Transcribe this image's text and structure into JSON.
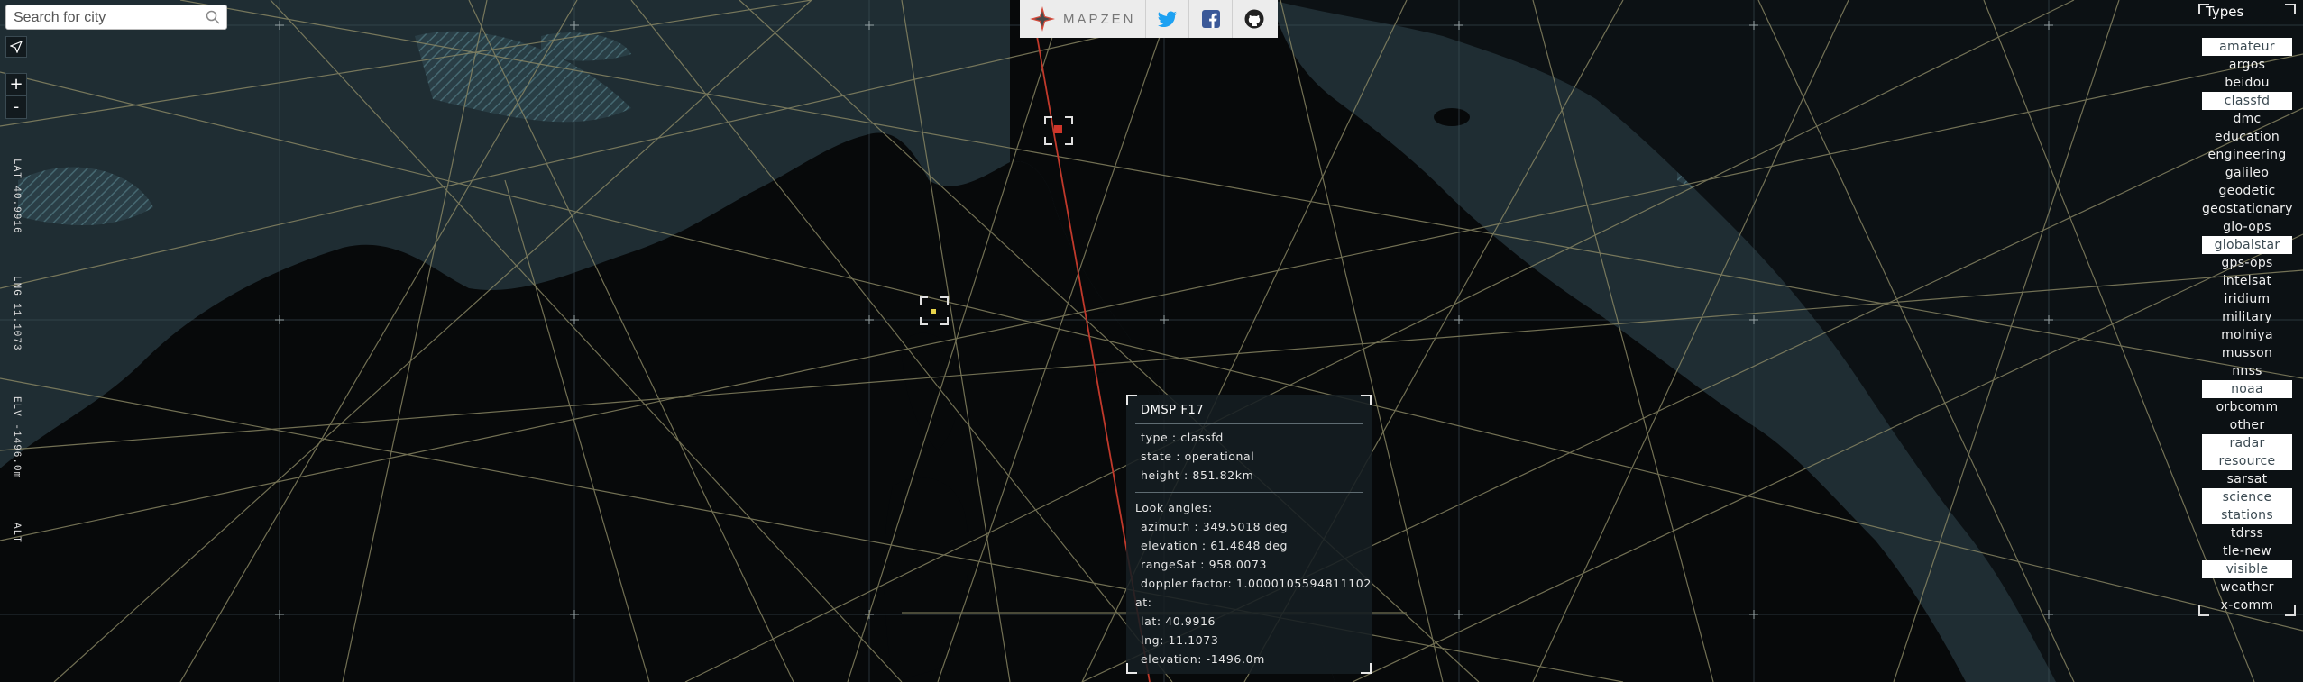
{
  "search": {
    "placeholder": "Search for city"
  },
  "controls": {
    "zoom_in": "+",
    "zoom_out": "-"
  },
  "coords": {
    "lat": "LAT 40.9916",
    "lng": "LNG 11.1073",
    "elv": "ELV -1496.0m",
    "alt": "ALT"
  },
  "header": {
    "brand": "MAPZEN"
  },
  "types": {
    "title": "Types",
    "items": [
      {
        "label": "amateur",
        "active": true
      },
      {
        "label": "argos",
        "active": false
      },
      {
        "label": "beidou",
        "active": false
      },
      {
        "label": "classfd",
        "active": true
      },
      {
        "label": "dmc",
        "active": false
      },
      {
        "label": "education",
        "active": false
      },
      {
        "label": "engineering",
        "active": false
      },
      {
        "label": "galileo",
        "active": false
      },
      {
        "label": "geodetic",
        "active": false
      },
      {
        "label": "geostationary",
        "active": false
      },
      {
        "label": "glo-ops",
        "active": false
      },
      {
        "label": "globalstar",
        "active": true
      },
      {
        "label": "gps-ops",
        "active": false
      },
      {
        "label": "intelsat",
        "active": false
      },
      {
        "label": "iridium",
        "active": false
      },
      {
        "label": "military",
        "active": false
      },
      {
        "label": "molniya",
        "active": false
      },
      {
        "label": "musson",
        "active": false
      },
      {
        "label": "nnss",
        "active": false
      },
      {
        "label": "noaa",
        "active": true
      },
      {
        "label": "orbcomm",
        "active": false
      },
      {
        "label": "other",
        "active": false
      },
      {
        "label": "radar resource",
        "active": true
      },
      {
        "label": "sarsat",
        "active": false
      },
      {
        "label": "science stations",
        "active": true
      },
      {
        "label": "tdrss",
        "active": false
      },
      {
        "label": "tle-new",
        "active": false
      },
      {
        "label": "visible",
        "active": true
      },
      {
        "label": "weather",
        "active": false
      },
      {
        "label": "x-comm",
        "active": false
      }
    ]
  },
  "info": {
    "name": "DMSP F17",
    "type": "type : classfd",
    "state": "state : operational",
    "height": "height : 851.82km",
    "look_angles": "Look angles:",
    "azimuth": "azimuth : 349.5018 deg",
    "elevation": "elevation : 61.4848 deg",
    "range": "rangeSat : 958.0073",
    "doppler": "doppler factor: 1.0000105594811102",
    "at": "at:",
    "lat": "lat: 40.9916",
    "lng": "lng: 11.1073",
    "elev": "elevation: -1496.0m"
  },
  "colors": {
    "land": "#07090a",
    "sea": "#1f2d33",
    "orbit": "#8d8a66",
    "selected_orbit": "#c0392b",
    "grid": "#4d5f66"
  }
}
